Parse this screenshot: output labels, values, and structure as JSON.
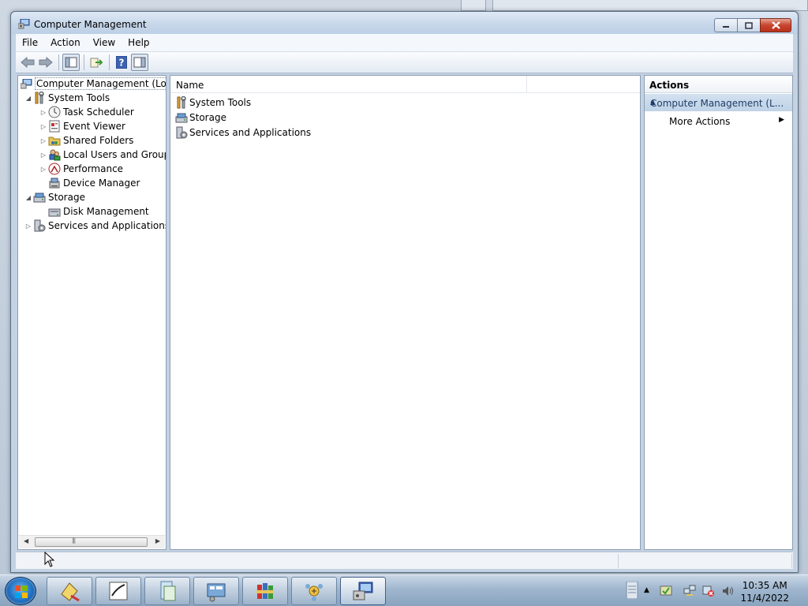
{
  "window": {
    "title": "Computer Management"
  },
  "menu": [
    "File",
    "Action",
    "View",
    "Help"
  ],
  "tree": {
    "root": "Computer Management (Local",
    "items": [
      {
        "label": "System Tools"
      },
      {
        "label": "Task Scheduler"
      },
      {
        "label": "Event Viewer"
      },
      {
        "label": "Shared Folders"
      },
      {
        "label": "Local Users and Groups"
      },
      {
        "label": "Performance"
      },
      {
        "label": "Device Manager"
      },
      {
        "label": "Storage"
      },
      {
        "label": "Disk Management"
      },
      {
        "label": "Services and Applications"
      }
    ]
  },
  "list": {
    "column_name": "Name",
    "rows": [
      "System Tools",
      "Storage",
      "Services and Applications"
    ]
  },
  "actions": {
    "header": "Actions",
    "section": "Computer Management (L...",
    "items": [
      "More Actions"
    ]
  },
  "clock": {
    "time": "10:35 AM",
    "date": "11/4/2022"
  },
  "colors": {
    "accent": "#1f6fc0",
    "section_bg": "#c9d9ec"
  }
}
